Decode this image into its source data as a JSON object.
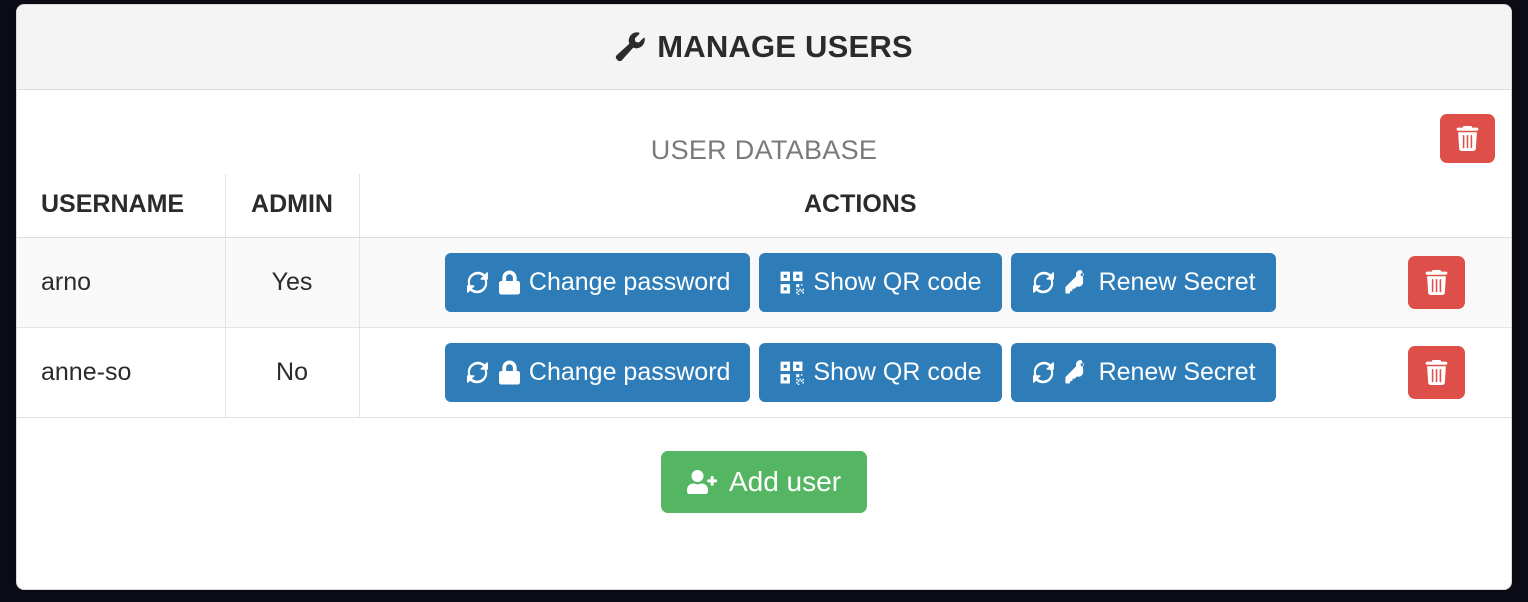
{
  "panel": {
    "title": "MANAGE USERS",
    "title_icon": "wrench-icon",
    "caption": "USER DATABASE"
  },
  "table": {
    "headers": {
      "username": "USERNAME",
      "admin": "ADMIN",
      "actions": "ACTIONS"
    },
    "rows": [
      {
        "username": "arno",
        "admin": "Yes",
        "actions": [
          {
            "label": "Change password",
            "icons": [
              "refresh-icon",
              "lock-icon"
            ],
            "style": "primary"
          },
          {
            "label": "Show QR code",
            "icons": [
              "qrcode-icon"
            ],
            "style": "primary"
          },
          {
            "label": "Renew Secret",
            "icons": [
              "refresh-icon",
              "key-icon"
            ],
            "style": "primary"
          }
        ],
        "delete_icon": "trash-icon"
      },
      {
        "username": "anne-so",
        "admin": "No",
        "actions": [
          {
            "label": "Change password",
            "icons": [
              "refresh-icon",
              "lock-icon"
            ],
            "style": "primary"
          },
          {
            "label": "Show QR code",
            "icons": [
              "qrcode-icon"
            ],
            "style": "primary"
          },
          {
            "label": "Renew Secret",
            "icons": [
              "refresh-icon",
              "key-icon"
            ],
            "style": "primary"
          }
        ],
        "delete_icon": "trash-icon"
      }
    ]
  },
  "buttons": {
    "delete_database_icon": "trash-icon",
    "add_user_label": "Add user",
    "add_user_icon": "user-plus-icon"
  },
  "colors": {
    "primary": "#2e7cb8",
    "danger": "#df4f4a",
    "success": "#54b662",
    "panel_header_bg": "#f4f4f4",
    "page_bg": "#0b0b16",
    "stripe": "#f9f9f9",
    "text": "#292b2c",
    "caption_text": "#7a7a7a"
  }
}
